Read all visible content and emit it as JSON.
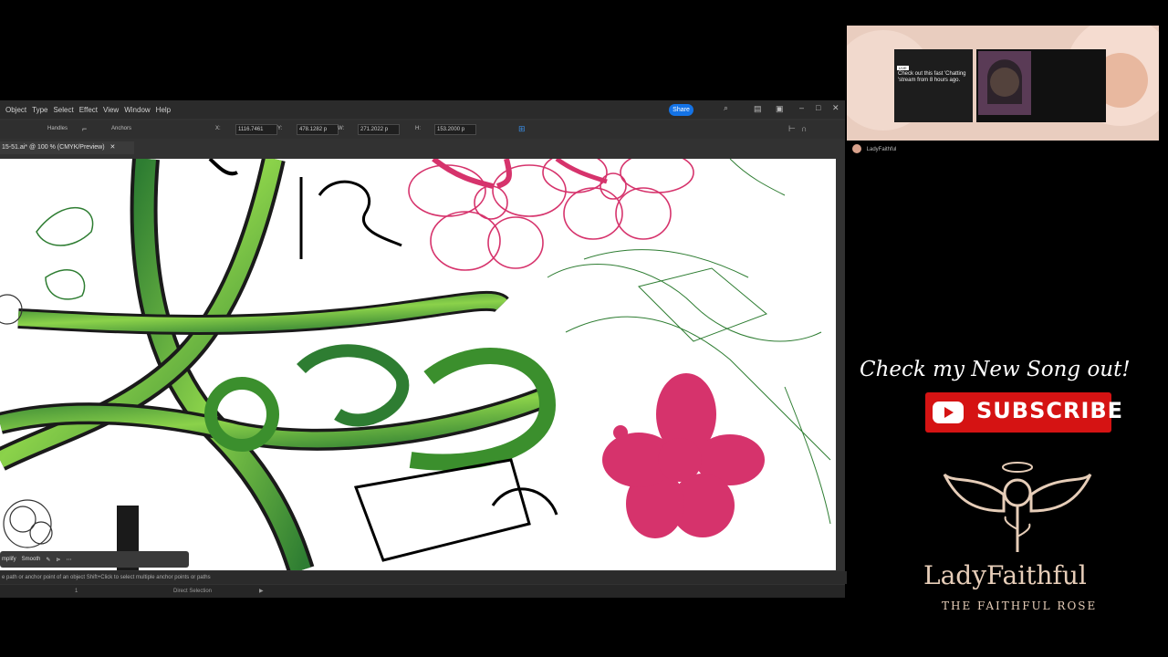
{
  "illustrator": {
    "menu": [
      "Object",
      "Type",
      "Select",
      "Effect",
      "View",
      "Window",
      "Help"
    ],
    "share_label": "Share",
    "control_bar": {
      "handles_label": "Handles",
      "anchors_label": "Anchors",
      "x_label": "X:",
      "x_value": "1116.7461",
      "y_label": "Y:",
      "y_value": "478.1282 p",
      "w_label": "W:",
      "w_value": "271.2022 p",
      "h_label": "H:",
      "h_value": "153.2000 p"
    },
    "doc_tab": "15-51.ai* @ 100 % (CMYK/Preview)",
    "context_bar": {
      "simplify_label": "mplify",
      "smooth_label": "Smooth"
    },
    "status_hint": "e path or anchor point of an object   Shift+Click to select multiple anchor points or paths",
    "bottom_bar": {
      "zoom": "1",
      "tool": "Direct Selection"
    }
  },
  "stream": {
    "promo": {
      "badge": "LIVE",
      "text": "Check out this fast 'Chatting 'stream from 8 hours ago."
    },
    "streamer_name": "LadyFaithful",
    "cta": "Check my New Song out!",
    "subscribe_label": "SUBSCRIBE",
    "brand_name": "LadyFaithful",
    "brand_tagline": "THE FAITHFUL ROSE"
  },
  "colors": {
    "accent_blue": "#1473e6",
    "youtube_red": "#d51313",
    "brand_gold": "#e6cdb8",
    "flower_pink": "#d6336c",
    "vine_green": "#4caf3a"
  }
}
